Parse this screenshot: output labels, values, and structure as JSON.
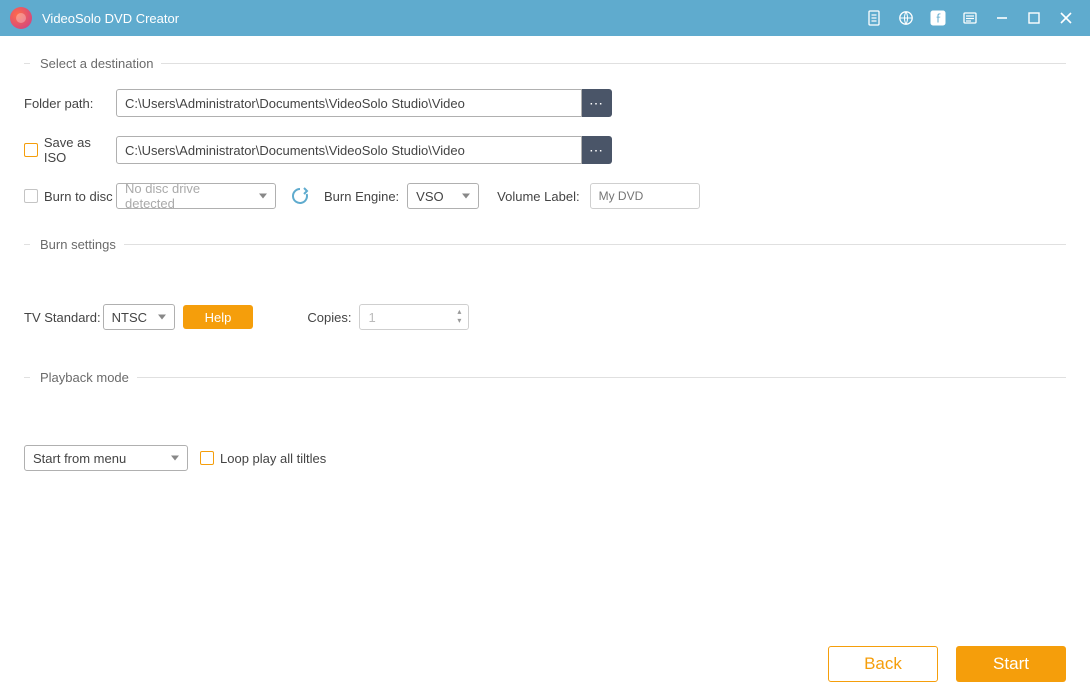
{
  "titlebar": {
    "title": "VideoSolo DVD Creator"
  },
  "sections": {
    "destination": {
      "title": "Select a destination",
      "folder_path_label": "Folder path:",
      "folder_path_value": "C:\\Users\\Administrator\\Documents\\VideoSolo Studio\\Video",
      "save_iso_label": "Save as ISO",
      "save_iso_value": "C:\\Users\\Administrator\\Documents\\VideoSolo Studio\\Video",
      "burn_disc_label": "Burn to disc",
      "disc_drive_value": "No disc drive detected",
      "burn_engine_label": "Burn Engine:",
      "burn_engine_value": "VSO",
      "volume_label_label": "Volume Label:",
      "volume_label_placeholder": "My DVD"
    },
    "burn": {
      "title": "Burn settings",
      "tv_standard_label": "TV Standard:",
      "tv_standard_value": "NTSC",
      "help_label": "Help",
      "copies_label": "Copies:",
      "copies_value": "1"
    },
    "playback": {
      "title": "Playback mode",
      "start_mode_value": "Start from menu",
      "loop_label": "Loop play all tiltles"
    }
  },
  "footer": {
    "back": "Back",
    "start": "Start"
  }
}
